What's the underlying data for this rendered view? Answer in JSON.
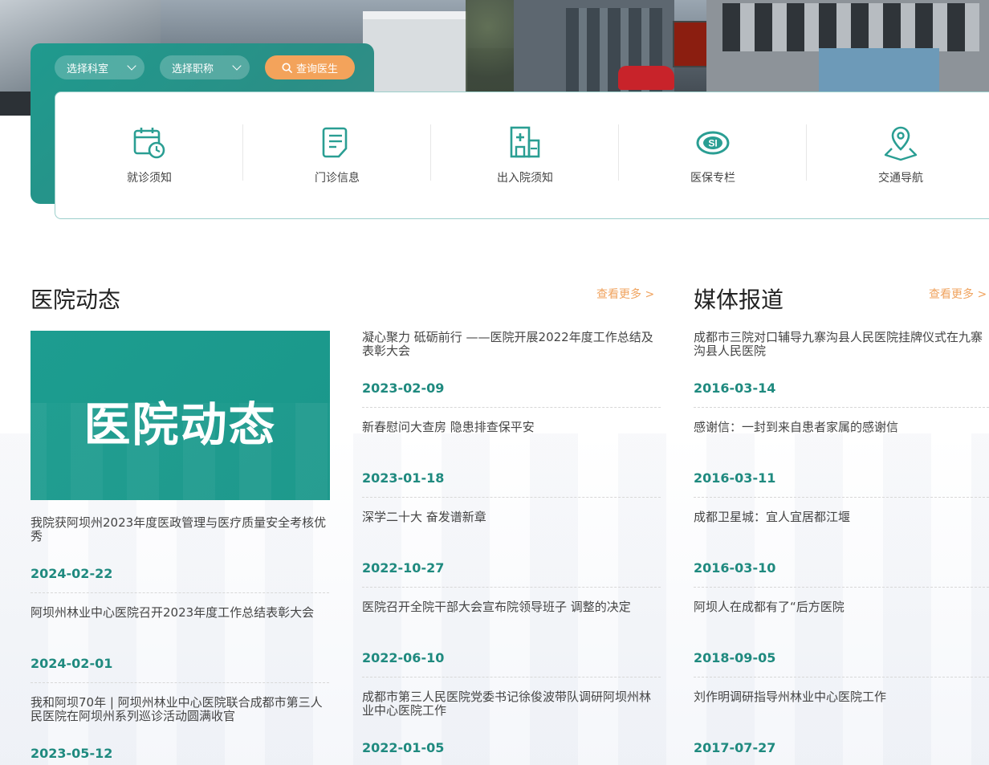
{
  "search": {
    "department_label": "选择科室",
    "title_label": "选择职称",
    "query_label": "查询医生"
  },
  "services": [
    {
      "label": "就诊须知",
      "icon": "calendar-clock-icon"
    },
    {
      "label": "门诊信息",
      "icon": "document-icon"
    },
    {
      "label": "出入院须知",
      "icon": "hospital-building-icon"
    },
    {
      "label": "医保专栏",
      "icon": "medical-insurance-icon"
    },
    {
      "label": "交通导航",
      "icon": "location-map-icon"
    }
  ],
  "hospital_news": {
    "title": "医院动态",
    "more": "查看更多 >",
    "feature_text": "医院动态",
    "left_items": [
      {
        "title": "我院获阿坝州2023年度医政管理与医疗质量安全考核优秀",
        "date": "2024-02-22"
      },
      {
        "title": "阿坝州林业中心医院召开2023年度工作总结表彰大会",
        "date": "2024-02-01"
      },
      {
        "title": "我和阿坝70年 | 阿坝州林业中心医院联合成都市第三人民医院在阿坝州系列巡诊活动圆满收官",
        "date": "2023-05-12"
      }
    ],
    "right_items": [
      {
        "title": "凝心聚力 砥砺前行 ——医院开展2022年度工作总结及表彰大会",
        "date": "2023-02-09"
      },
      {
        "title": "新春慰问大查房 隐患排查保平安",
        "date": "2023-01-18"
      },
      {
        "title": "深学二十大 奋发谱新章",
        "date": "2022-10-27"
      },
      {
        "title": "医院召开全院干部大会宣布院领导班子 调整的决定",
        "date": "2022-06-10"
      },
      {
        "title": "成都市第三人民医院党委书记徐俊波带队调研阿坝州林业中心医院工作",
        "date": "2022-01-05"
      }
    ]
  },
  "media": {
    "title": "媒体报道",
    "more": "查看更多 >",
    "items": [
      {
        "title": "成都市三院对口辅导九寨沟县人民医院挂牌仪式在九寨沟县人民医院",
        "date": "2016-03-14"
      },
      {
        "title": "感谢信：一封到来自患者家属的感谢信",
        "date": "2016-03-11"
      },
      {
        "title": "成都卫星城：宜人宜居都江堰",
        "date": "2016-03-10"
      },
      {
        "title": "阿坝人在成都有了“后方医院",
        "date": "2018-09-05"
      },
      {
        "title": "刘作明调研指导州林业中心医院工作",
        "date": "2017-07-27"
      }
    ]
  },
  "colors": {
    "teal": "#1f9a8e",
    "orange": "#f3a35b",
    "date_green": "#1f8a7f",
    "more_orange": "#f0a35e"
  }
}
